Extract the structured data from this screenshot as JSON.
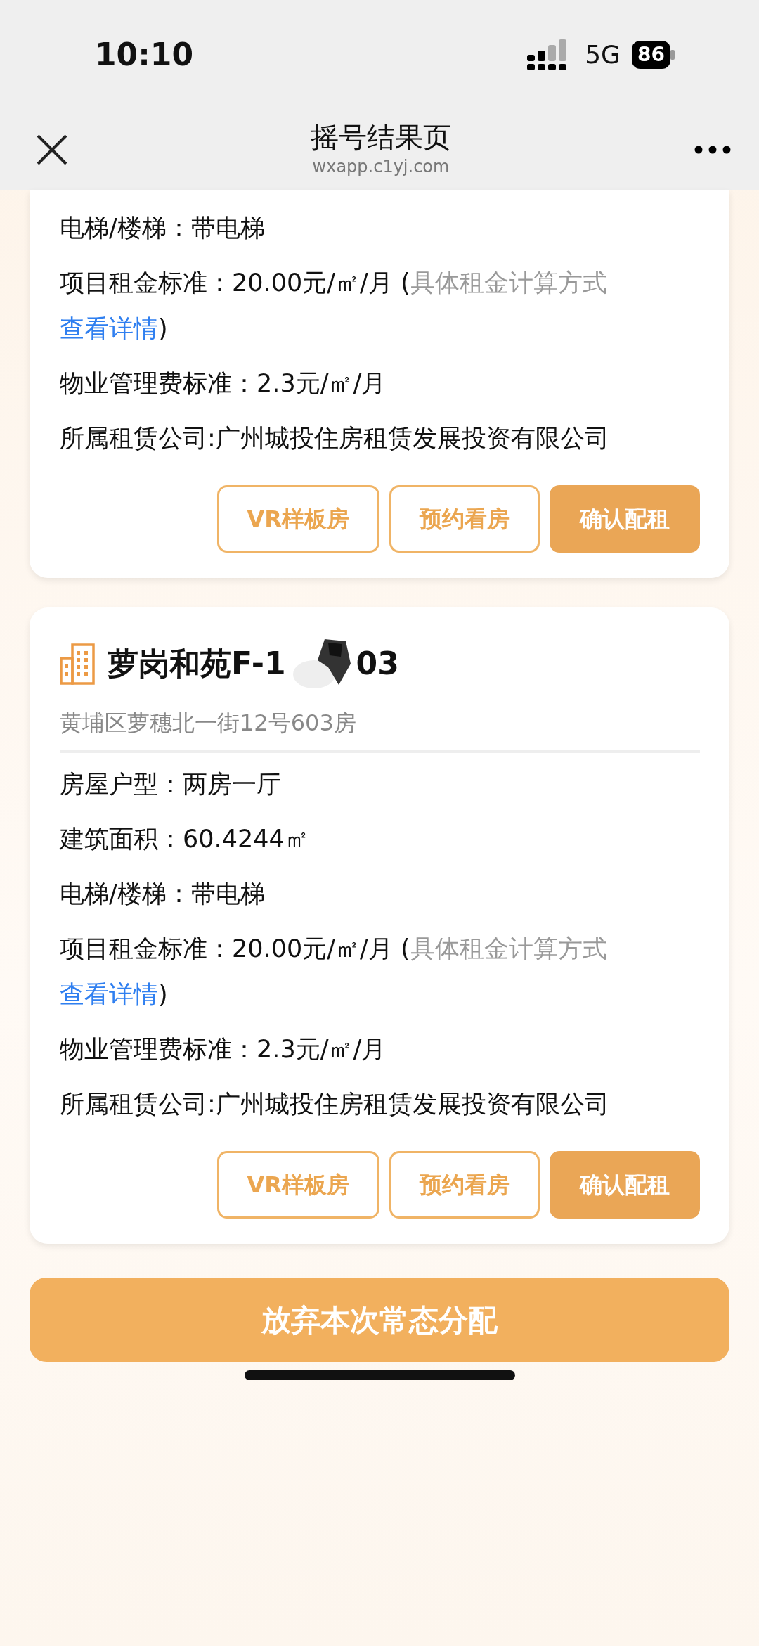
{
  "status_bar": {
    "time": "10:10",
    "network": "5G",
    "battery": "86"
  },
  "nav": {
    "title": "摇号结果页",
    "subtitle": "wxapp.c1yj.com"
  },
  "cards": [
    {
      "rows": [
        {
          "label": "电梯/楼梯：",
          "value": "带电梯"
        },
        {
          "label": "项目租金标准：",
          "value": "20.00元/㎡/月 (",
          "note": "具体租金计算方式",
          "link": "查看详情",
          "suffix": ")"
        },
        {
          "label": "物业管理费标准：",
          "value": "2.3元/㎡/月"
        },
        {
          "label": "所属租赁公司:",
          "value": "广州城投住房租赁发展投资有限公司"
        }
      ],
      "buttons": [
        {
          "label": "VR样板房",
          "kind": "outline"
        },
        {
          "label": "预约看房",
          "kind": "outline"
        },
        {
          "label": "确认配租",
          "kind": "filled"
        }
      ]
    },
    {
      "title_start": "萝岗和苑F-1",
      "title_end": "03",
      "address": "黄埔区萝穗北一街12号603房",
      "rows": [
        {
          "label": "房屋户型：",
          "value": "两房一厅"
        },
        {
          "label": "建筑面积：",
          "value": "60.4244㎡"
        },
        {
          "label": "电梯/楼梯：",
          "value": "带电梯"
        },
        {
          "label": "项目租金标准：",
          "value": "20.00元/㎡/月 (",
          "note": "具体租金计算方式",
          "link": "查看详情",
          "suffix": ")"
        },
        {
          "label": "物业管理费标准：",
          "value": "2.3元/㎡/月"
        },
        {
          "label": "所属租赁公司:",
          "value": "广州城投住房租赁发展投资有限公司"
        }
      ],
      "buttons": [
        {
          "label": "VR样板房",
          "kind": "outline"
        },
        {
          "label": "预约看房",
          "kind": "outline"
        },
        {
          "label": "确认配租",
          "kind": "filled"
        }
      ]
    }
  ],
  "bottom_button": "放弃本次常态分配"
}
